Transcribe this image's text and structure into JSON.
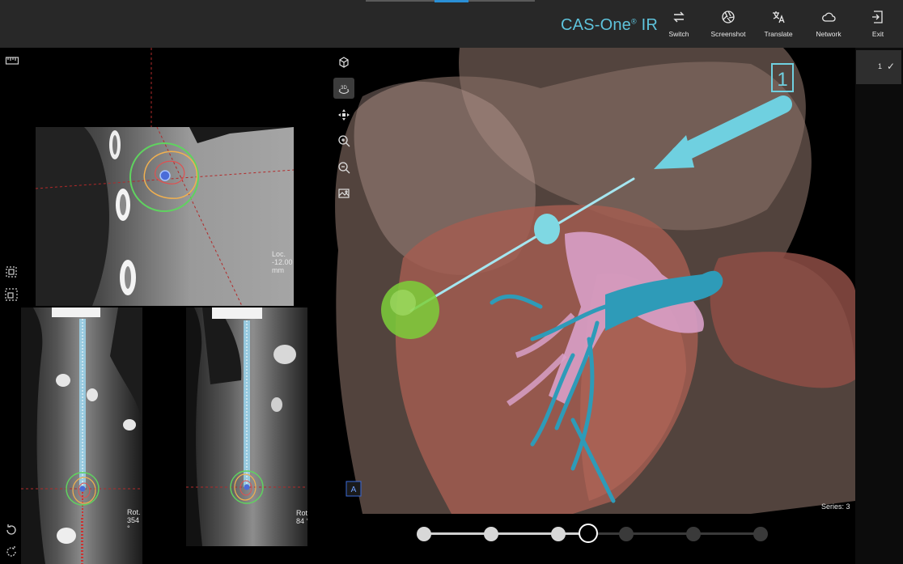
{
  "header": {
    "app_title": "CAS-One",
    "app_title_suffix": "IR",
    "registered_mark": "®",
    "tools": [
      {
        "name": "switch",
        "label": "Switch"
      },
      {
        "name": "screenshot",
        "label": "Screenshot"
      },
      {
        "name": "translate",
        "label": "Translate"
      },
      {
        "name": "network",
        "label": "Network"
      },
      {
        "name": "exit",
        "label": "Exit"
      }
    ]
  },
  "views": {
    "axial": {
      "location": "Loc. -12.00 mm"
    },
    "sagittal_left": {
      "rotation": "Rot. 354 °"
    },
    "sagittal_right": {
      "rotation": "Rot. 84 °"
    }
  },
  "view3d": {
    "series": "Series: 3",
    "trajectory_label": "1",
    "toolbar": [
      "reset-view",
      "3d-rotate",
      "pan",
      "zoom-in",
      "zoom-out",
      "snapshot"
    ],
    "toolbar_3d_label": "3D",
    "orientation_label": "A"
  },
  "right_panel": {
    "series_number": "1",
    "check": "✓"
  },
  "slider": {
    "steps": 8,
    "current_step": 4
  },
  "colors": {
    "accent": "#5ec3dc",
    "topbar": "#282828",
    "tab_indicator": "#2a8fd6",
    "needle": "#7fd8e3",
    "target": "#7ccf3a"
  }
}
